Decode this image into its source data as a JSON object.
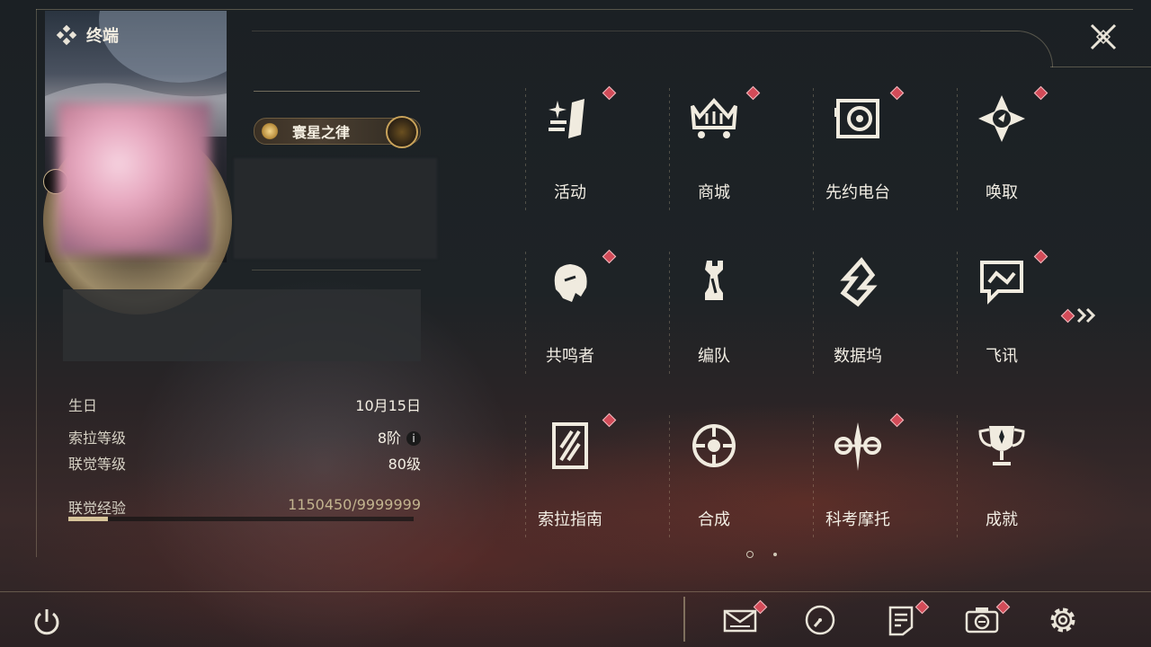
{
  "header": {
    "title": "终端"
  },
  "profile": {
    "badge_label": "寰星之律",
    "info": [
      {
        "label": "生日",
        "value": "10月15日"
      },
      {
        "label": "索拉等级",
        "value": "8阶"
      },
      {
        "label": "联觉等级",
        "value": "80级"
      },
      {
        "label": "联觉经验",
        "value": "1150450/9999999"
      }
    ],
    "exp_fraction": 0.115
  },
  "menu": {
    "items": [
      {
        "label": "活动",
        "icon": "activity-icon",
        "alert": true
      },
      {
        "label": "商城",
        "icon": "shop-crown-cart-icon",
        "alert": true
      },
      {
        "label": "先约电台",
        "icon": "radio-speaker-icon",
        "alert": true
      },
      {
        "label": "唤取",
        "icon": "convene-compass-icon",
        "alert": true
      },
      {
        "label": "共鸣者",
        "icon": "resonator-portrait-icon",
        "alert": true
      },
      {
        "label": "编队",
        "icon": "chess-team-icon",
        "alert": false
      },
      {
        "label": "数据坞",
        "icon": "data-bank-icon",
        "alert": false
      },
      {
        "label": "飞讯",
        "icon": "chat-message-icon",
        "alert": true
      },
      {
        "label": "索拉指南",
        "icon": "guide-book-icon",
        "alert": true
      },
      {
        "label": "合成",
        "icon": "synthesis-icon",
        "alert": false
      },
      {
        "label": "科考摩托",
        "icon": "motorbike-icon",
        "alert": true
      },
      {
        "label": "成就",
        "icon": "trophy-icon",
        "alert": false
      }
    ]
  },
  "toolbar": [
    "mail-icon",
    "clock-icon",
    "notes-icon",
    "camera-icon",
    "settings-gear-icon"
  ],
  "colors": {
    "alert": "#d24b58",
    "accent": "#d7c49a",
    "text": "#f2eee4"
  }
}
